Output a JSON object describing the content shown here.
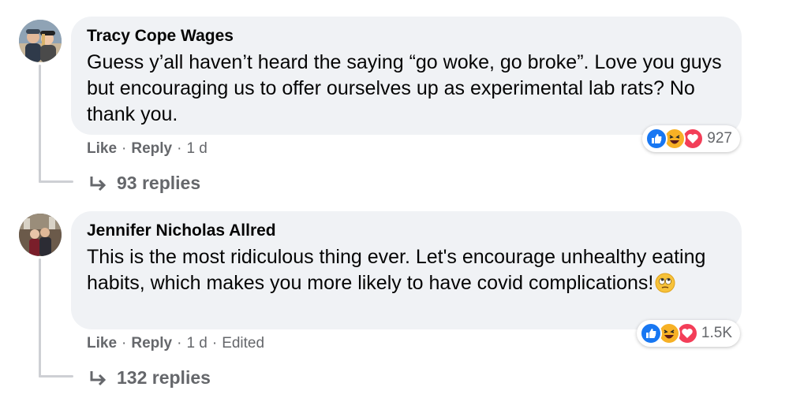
{
  "comments": [
    {
      "author": "Tracy Cope Wages",
      "text": "Guess y’all haven’t heard the saying “go woke, go broke”. Love you guys but encouraging us to offer ourselves up as experimental lab rats? No thank you.",
      "like_label": "Like",
      "reply_label": "Reply",
      "time": "1 d",
      "reaction_count": "927",
      "reaction_icons": [
        "like-icon",
        "haha-icon",
        "love-icon"
      ],
      "replies_label": "93 replies"
    },
    {
      "author": "Jennifer Nicholas Allred",
      "text": "This is the most ridiculous thing ever. Let's encourage unhealthy eating habits, which makes you more likely to have covid complications!",
      "text_emoji": "eye-roll-emoji",
      "like_label": "Like",
      "reply_label": "Reply",
      "time": "1 d",
      "edited_label": "Edited",
      "reaction_count": "1.5K",
      "reaction_icons": [
        "like-icon",
        "haha-icon",
        "love-icon"
      ],
      "replies_label": "132 replies"
    }
  ],
  "colors": {
    "bubble": "#f0f2f5",
    "secondary_text": "#65676b",
    "like_blue": "#1877f2",
    "love_red": "#f33e58",
    "haha_yellow": "#f7b125"
  }
}
